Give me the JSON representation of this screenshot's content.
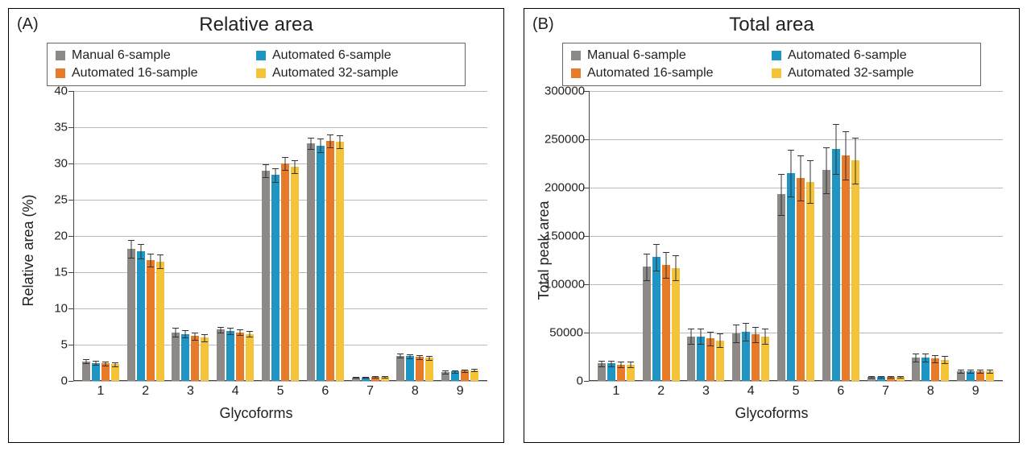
{
  "chart_data": [
    {
      "id": "A",
      "panel_label": "(A)",
      "type": "bar",
      "title": "Relative area",
      "xlabel": "Glycoforms",
      "ylabel": "Relative area (%)",
      "ylim": [
        0,
        40
      ],
      "ytick_step": 5,
      "categories": [
        "1",
        "2",
        "3",
        "4",
        "5",
        "6",
        "7",
        "8",
        "9"
      ],
      "series": [
        {
          "name": "Manual 6-sample",
          "color": "#8d8986",
          "values": [
            2.7,
            18.2,
            6.7,
            7.1,
            29.0,
            32.8,
            0.5,
            3.5,
            1.2
          ],
          "errors": [
            0.3,
            1.2,
            0.6,
            0.4,
            0.9,
            0.8,
            0.1,
            0.3,
            0.2
          ]
        },
        {
          "name": "Automated 6-sample",
          "color": "#1f95c4",
          "values": [
            2.5,
            17.9,
            6.5,
            6.9,
            28.4,
            32.5,
            0.5,
            3.4,
            1.3
          ],
          "errors": [
            0.3,
            1.0,
            0.5,
            0.4,
            0.9,
            0.9,
            0.1,
            0.3,
            0.2
          ]
        },
        {
          "name": "Automated 16-sample",
          "color": "#e87b2a",
          "values": [
            2.4,
            16.7,
            6.2,
            6.7,
            30.0,
            33.1,
            0.6,
            3.3,
            1.4
          ],
          "errors": [
            0.3,
            0.9,
            0.5,
            0.4,
            0.9,
            0.9,
            0.1,
            0.3,
            0.2
          ]
        },
        {
          "name": "Automated 32-sample",
          "color": "#f4c33a",
          "values": [
            2.3,
            16.5,
            6.0,
            6.5,
            29.6,
            33.0,
            0.6,
            3.2,
            1.5
          ],
          "errors": [
            0.3,
            0.9,
            0.5,
            0.4,
            0.9,
            0.9,
            0.1,
            0.3,
            0.2
          ]
        }
      ]
    },
    {
      "id": "B",
      "panel_label": "(B)",
      "type": "bar",
      "title": "Total area",
      "xlabel": "Glycoforms",
      "ylabel": "Total peak area",
      "ylim": [
        0,
        300000
      ],
      "ytick_step": 50000,
      "categories": [
        "1",
        "2",
        "3",
        "4",
        "5",
        "6",
        "7",
        "8",
        "9"
      ],
      "series": [
        {
          "name": "Manual 6-sample",
          "color": "#8d8986",
          "values": [
            18000,
            118000,
            46000,
            49000,
            193000,
            218000,
            4000,
            24000,
            10000
          ],
          "errors": [
            3000,
            14000,
            8000,
            9000,
            21000,
            24000,
            1000,
            4000,
            2000
          ]
        },
        {
          "name": "Automated 6-sample",
          "color": "#1f95c4",
          "values": [
            18000,
            128000,
            46000,
            51000,
            215000,
            240000,
            4000,
            24000,
            10000
          ],
          "errors": [
            3000,
            14000,
            8000,
            9000,
            24000,
            26000,
            1000,
            4000,
            2000
          ]
        },
        {
          "name": "Automated 16-sample",
          "color": "#e87b2a",
          "values": [
            17000,
            120000,
            44000,
            48000,
            210000,
            233000,
            4000,
            23000,
            10000
          ],
          "errors": [
            3000,
            13000,
            7000,
            8000,
            23000,
            25000,
            1000,
            4000,
            2000
          ]
        },
        {
          "name": "Automated 32-sample",
          "color": "#f4c33a",
          "values": [
            17000,
            117000,
            42000,
            46000,
            206000,
            228000,
            4000,
            22000,
            10000
          ],
          "errors": [
            3000,
            13000,
            7000,
            8000,
            22000,
            24000,
            1000,
            4000,
            2000
          ]
        }
      ]
    }
  ]
}
